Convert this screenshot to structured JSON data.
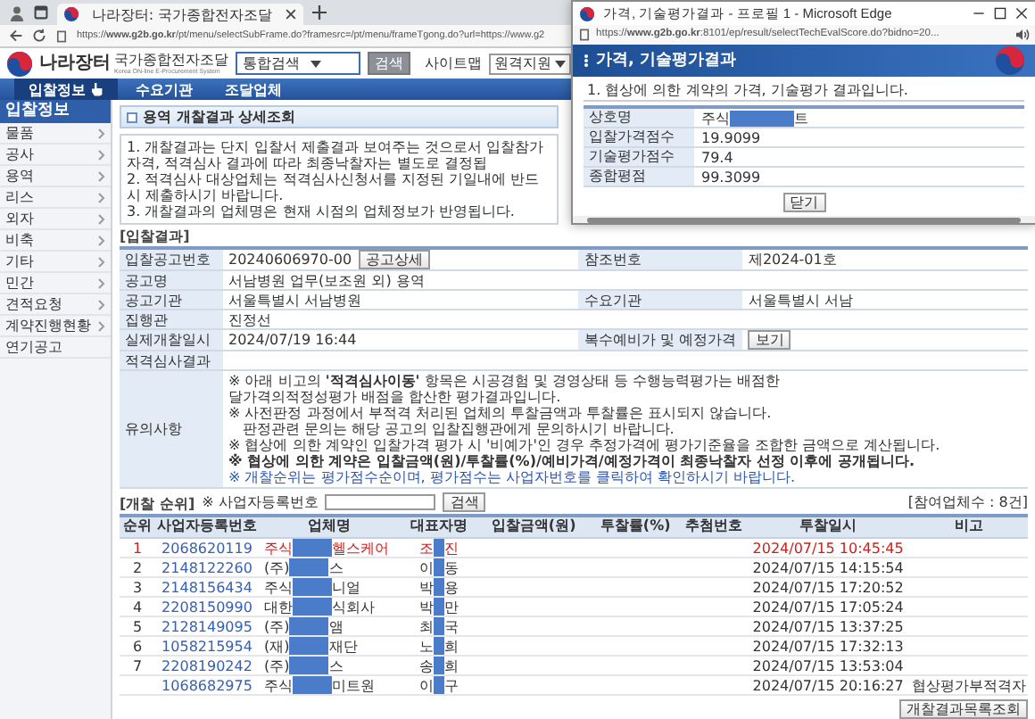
{
  "browser": {
    "tab_title": "나라장터: 국가종합전자조달",
    "url": "https://**www.g2b.go.kr**/pt/menu/selectSubFrame.do?framesrc=/pt/menu/frameTgong.do?url=https://www.g2"
  },
  "header": {
    "logo": "나라장터",
    "logo_subtitle": "국가종합전자조달",
    "logo_subtitle_en": "Korea ON-line E-Procurement System",
    "search_scope": "통합검색",
    "search_button": "검색",
    "sitemap": "사이트맵",
    "remote_support": "원격지원"
  },
  "nav": [
    {
      "label": "입찰정보",
      "selected": true
    },
    {
      "label": "수요기관",
      "selected": false
    },
    {
      "label": "조달업체",
      "selected": false
    }
  ],
  "sidebar": {
    "title": "입찰정보",
    "items": [
      {
        "label": "물품",
        "submenu": true
      },
      {
        "label": "공사",
        "submenu": true
      },
      {
        "label": "용역",
        "submenu": true
      },
      {
        "label": "리스",
        "submenu": true
      },
      {
        "label": "외자",
        "submenu": true
      },
      {
        "label": "비축",
        "submenu": true
      },
      {
        "label": "기타",
        "submenu": true
      },
      {
        "label": "민간",
        "submenu": true
      },
      {
        "label": "견적요청",
        "submenu": true
      },
      {
        "label": "계약진행현황",
        "submenu": true
      },
      {
        "label": "연기공고",
        "submenu": false
      }
    ]
  },
  "page_title": "용역 개찰결과 상세조회",
  "notes": [
    "1. 개찰결과는 단지 입찰서 제출결과 보여주는 것으로서 입찰참가자격, 적격심사 결과에 따라 최종낙찰자는 별도로 결정됩",
    "2. 적격심사 대상업체는 적격심사신청서를 지정된 기일내에 반드시 제출하시기 바랍니다.",
    "3. 개찰결과의 업체명은 현재 시점의 업체정보가 반영됩니다."
  ],
  "bid_result": {
    "heading": "[입찰결과]",
    "notice_no": {
      "label": "입찰공고번호",
      "value": "20240606970-00",
      "button": "공고상세"
    },
    "reference_no": {
      "label": "참조번호",
      "value": "제2024-01호"
    },
    "notice_name": {
      "label": "공고명",
      "value": "서남병원 업무(보조원 외) 용역"
    },
    "notice_agency": {
      "label": "공고기관",
      "value": "서울특별시 서남병원"
    },
    "demand_agency": {
      "label": "수요기관",
      "value": "서울특별시 서남"
    },
    "officer": {
      "label": "집행관",
      "value": "진정선"
    },
    "opening_time": {
      "label": "실제개찰일시",
      "value": "2024/07/19 16:44"
    },
    "price": {
      "label": "복수예비가 및 예정가격",
      "button": "보기"
    },
    "qualification": {
      "label": "적격심사결과"
    },
    "remarks": {
      "label": "유의사항",
      "lines": [
        {
          "text": "※ 아래 비고의 **'적격심사이동'** 항목은 시공경험 및 경영상태 등 수행능력평가는 배점한",
          "kind": "plain"
        },
        {
          "text": "달가격의적정성평가 배점을 합산한 평가결과입니다.",
          "kind": "plain"
        },
        {
          "text": "※ 사전판정 과정에서 부적격 처리된 업체의 투찰금액과 투찰률은 표시되지 않습니다.",
          "kind": "plain"
        },
        {
          "text": "판정관련 문의는 해당 공고의 입찰집행관에게 문의하시기 바랍니다.",
          "kind": "indent"
        },
        {
          "text": "※ 협상에 의한 계약인 입찰가격 평가 시 '비예가'인 경우 추정가격에 평가기준율을 조합한 금액으로 계산됩니다.",
          "kind": "plain"
        },
        {
          "text": "※ 협상에 의한 계약은 입찰금액(원)/투찰률(%)/예비가격/예정가격이 최종낙찰자 선정 이후에 공개됩니다.",
          "kind": "bold"
        },
        {
          "text": "※ 개찰순위는 평가점수순이며, 평가점수는 사업자번호를 클릭하여 확인하시기 바랍니다.",
          "kind": "link"
        }
      ]
    }
  },
  "ranking": {
    "heading": "[개찰 순위]",
    "search_label": "※ 사업자등록번호",
    "search_button": "검색",
    "count": "[참여업체수 : 8건]",
    "columns": [
      "순위",
      "사업자등록번호",
      "업체명",
      "대표자명",
      "입찰금액(원)",
      "투찰률(%)",
      "추첨번호",
      "투찰일시",
      "비고"
    ],
    "rows": [
      {
        "rank": "1",
        "biz_no": "2068620119",
        "company_start": "주식",
        "company_end": "헬스케어",
        "rep_start": "조",
        "rep_end": "진",
        "time": "2024/07/15 10:45:45",
        "highlighted": true
      },
      {
        "rank": "2",
        "biz_no": "2148122260",
        "company_start": "(주)",
        "company_end": "스",
        "rep_start": "이",
        "rep_end": "동",
        "time": "2024/07/15 14:15:54",
        "highlighted": false
      },
      {
        "rank": "3",
        "biz_no": "2148156434",
        "company_start": "주식",
        "company_end": "니얼",
        "rep_start": "박",
        "rep_end": "용",
        "time": "2024/07/15 17:20:52",
        "highlighted": false
      },
      {
        "rank": "4",
        "biz_no": "2208150990",
        "company_start": "대한",
        "company_end": "식회사",
        "rep_start": "박",
        "rep_end": "만",
        "time": "2024/07/15 17:05:24",
        "highlighted": false
      },
      {
        "rank": "5",
        "biz_no": "2128149095",
        "company_start": "(주)",
        "company_end": "앰",
        "rep_start": "최",
        "rep_end": "국",
        "time": "2024/07/15 13:37:25",
        "highlighted": false
      },
      {
        "rank": "6",
        "biz_no": "1058215954",
        "company_start": "(재)",
        "company_end": "재단",
        "rep_start": "노",
        "rep_end": "희",
        "time": "2024/07/15 17:32:13",
        "highlighted": false
      },
      {
        "rank": "7",
        "biz_no": "2208190242",
        "company_start": "(주)",
        "company_end": "스",
        "rep_start": "송",
        "rep_end": "희",
        "time": "2024/07/15 13:53:04",
        "highlighted": false
      },
      {
        "biz_no": "1068682975",
        "company_start": "주식",
        "company_end": "미트원",
        "rep_start": "이",
        "rep_end": "구",
        "time": "2024/07/15 20:16:27",
        "note": "협상평가부적격자",
        "highlighted": false
      }
    ],
    "list_button": "개찰결과목록조회"
  },
  "popup": {
    "title": "가격, 기술평가결과 - 프로필 1 - Microsoft Edge",
    "url": "https://**www.g2b.go.kr**:8101/ep/result/selectTechEvalScore.do?bidno=20...",
    "heading": "가격, 기술평가결과",
    "note": "1. 협상에 의한 계약의 가격, 기술평가 결과입니다.",
    "rows": [
      {
        "label": "상호명",
        "kind": "redacted",
        "value_start": "주식",
        "value_end": "트"
      },
      {
        "label": "입찰가격점수",
        "kind": "plain",
        "value": "19.9099"
      },
      {
        "label": "기술평가점수",
        "kind": "plain",
        "value": "79.4"
      },
      {
        "label": "종합평점",
        "kind": "plain",
        "value": "99.3099"
      }
    ],
    "close_button": "닫기"
  }
}
